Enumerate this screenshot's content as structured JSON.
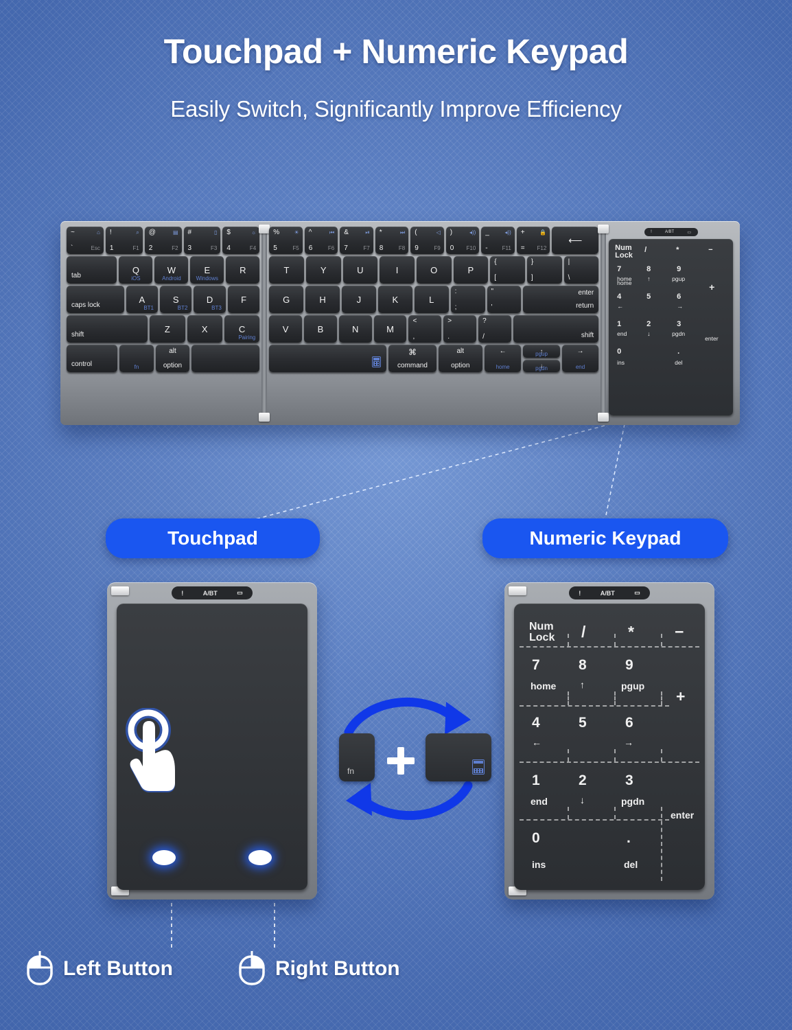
{
  "headings": {
    "title": "Touchpad + Numeric Keypad",
    "subtitle": "Easily Switch, Significantly Improve Efficiency"
  },
  "colors": {
    "background_blue": "#5a7fc4",
    "accent_blue": "#1a56f0",
    "key_black": "#2a2d31",
    "frame_silver": "#9fa3a8",
    "legend_blue": "#5f7fd0"
  },
  "callouts": {
    "touchpad_label": "Touchpad",
    "numeric_label": "Numeric Keypad"
  },
  "keyboard": {
    "status_strip": {
      "indicator": "!",
      "mode": "A/BT",
      "battery": "battery-icon"
    },
    "number_row": [
      {
        "top": "~",
        "bottom": "`",
        "alt": "Esc",
        "alt_icon": "home-icon"
      },
      {
        "top": "!",
        "bottom": "1",
        "alt": "F1",
        "alt_icon": "search-icon"
      },
      {
        "top": "@",
        "bottom": "2",
        "alt": "F2",
        "alt_icon": "keyboard-icon"
      },
      {
        "top": "#",
        "bottom": "3",
        "alt": "F3",
        "alt_icon": "display-icon"
      },
      {
        "top": "$",
        "bottom": "4",
        "alt": "F4",
        "alt_icon": "brightness-icon"
      },
      {
        "top": "%",
        "bottom": "5",
        "alt": "F5",
        "alt_icon": "brightness-up-icon"
      },
      {
        "top": "^",
        "bottom": "6",
        "alt": "F6",
        "alt_icon": "prev-track-icon"
      },
      {
        "top": "&",
        "bottom": "7",
        "alt": "F7",
        "alt_icon": "play-pause-icon"
      },
      {
        "top": "*",
        "bottom": "8",
        "alt": "F8",
        "alt_icon": "next-track-icon"
      },
      {
        "top": "(",
        "bottom": "9",
        "alt": "F9",
        "alt_icon": "mute-icon"
      },
      {
        "top": ")",
        "bottom": "0",
        "alt": "F10",
        "alt_icon": "volume-down-icon"
      },
      {
        "top": "_",
        "bottom": "-",
        "alt": "F11",
        "alt_icon": "volume-up-icon"
      },
      {
        "top": "+",
        "bottom": "=",
        "alt": "F12",
        "alt_icon": "lock-icon"
      },
      {
        "top": "",
        "bottom": "backspace-arrow",
        "alt": "",
        "alt_icon": "delete-icon"
      }
    ],
    "row_q": {
      "tab": "tab",
      "keys": [
        "Q",
        "W",
        "E",
        "R",
        "T",
        "Y",
        "U",
        "I",
        "O",
        "P"
      ],
      "subs": [
        "iOS",
        "Android",
        "Windows",
        "",
        "",
        "",
        "",
        "",
        "",
        ""
      ],
      "bracket_open": {
        "top": "{",
        "bottom": "["
      },
      "bracket_close": {
        "top": "}",
        "bottom": "]"
      },
      "pipe": {
        "top": "|",
        "bottom": "\\"
      }
    },
    "row_a": {
      "caps": "caps lock",
      "keys": [
        "A",
        "S",
        "D",
        "F",
        "G",
        "H",
        "J",
        "K",
        "L"
      ],
      "subs": [
        "BT1",
        "BT2",
        "BT3",
        "",
        "",
        "",
        "",
        "",
        ""
      ],
      "semicolon": {
        "top": ":",
        "bottom": ";"
      },
      "quote": {
        "top": "\"",
        "bottom": "'"
      },
      "enter": {
        "top": "enter",
        "bottom": "return"
      }
    },
    "row_z": {
      "shift_left": "shift",
      "keys": [
        "Z",
        "X",
        "C",
        "V",
        "B",
        "N",
        "M"
      ],
      "subs": [
        "",
        "",
        "Pairing",
        "",
        "",
        "",
        ""
      ],
      "comma": {
        "top": "<",
        "bottom": ","
      },
      "period": {
        "top": ">",
        "bottom": "."
      },
      "slash": {
        "top": "?",
        "bottom": "/"
      },
      "shift_right": "shift"
    },
    "row_bottom": {
      "control": "control",
      "fn": "fn",
      "alt_option": {
        "top": "alt",
        "bottom": "option"
      },
      "space_icon": "calculator-icon",
      "command": {
        "top": "⌘",
        "bottom": "command"
      },
      "alt_option_right": {
        "top": "alt",
        "bottom": "option"
      },
      "arrow_left": {
        "glyph": "←",
        "sub": "home"
      },
      "arrow_up": {
        "glyph": "↑",
        "sub": "pgup"
      },
      "arrow_down": {
        "glyph": "↓",
        "sub": "pgdn"
      },
      "arrow_right": {
        "glyph": "→",
        "sub": "end"
      }
    }
  },
  "numpad": {
    "status_strip": {
      "indicator": "!",
      "mode": "A/BT",
      "battery": "battery-icon"
    },
    "rows": [
      [
        {
          "main": "Num Lock",
          "sub": ""
        },
        {
          "main": "/",
          "sub": ""
        },
        {
          "main": "*",
          "sub": ""
        }
      ],
      [
        {
          "main": "7",
          "sub": "home"
        },
        {
          "main": "8",
          "sub": "↑"
        },
        {
          "main": "9",
          "sub": "pgup"
        }
      ],
      [
        {
          "main": "4",
          "sub": "←"
        },
        {
          "main": "5",
          "sub": ""
        },
        {
          "main": "6",
          "sub": "→"
        }
      ],
      [
        {
          "main": "1",
          "sub": "end"
        },
        {
          "main": "2",
          "sub": "↓"
        },
        {
          "main": "3",
          "sub": "pgdn"
        }
      ],
      [
        {
          "main": "0",
          "sub": "ins"
        },
        {
          "main": ".",
          "sub": ""
        },
        {
          "main": "",
          "sub": "del"
        }
      ]
    ],
    "minus": "−",
    "plus": "+",
    "enter": "enter",
    "num_lock_line1": "Num",
    "num_lock_line2": "Lock"
  },
  "switch_graphic": {
    "fn_key": "fn",
    "plus": "+",
    "space_key_icon": "calculator-icon",
    "arrows": "circular-swap-arrows"
  },
  "bottom_labels": {
    "left_button": "Left Button",
    "right_button": "Right Button"
  }
}
